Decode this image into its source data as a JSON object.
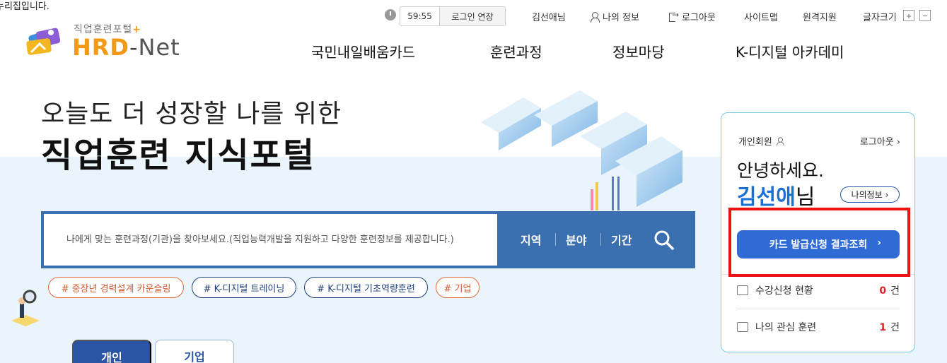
{
  "top_note": "누리집입니다.",
  "logo": {
    "subtitle": "직업훈련포털",
    "plus": "+",
    "main": "HRD",
    "dash": "-",
    "net": "Net"
  },
  "util": {
    "timer": "59:55",
    "extend_label": "로그인 연장",
    "user_greeting": "김선애님",
    "myinfo": "나의 정보",
    "logout": "로그아웃",
    "sitemap": "사이트맵",
    "remote": "원격지원",
    "font_size": "글자크기",
    "plus": "+",
    "minus": "−"
  },
  "gnb": [
    "국민내일배움카드",
    "훈련과정",
    "정보마당",
    "K-디지털 아카데미"
  ],
  "hero": {
    "line1": "오늘도 더 성장할 나를 위한",
    "line2": "직업훈련 지식포털"
  },
  "search": {
    "placeholder": "나에게 맞는 훈련과정(기관)을 찾아보세요.(직업능력개발을 지원하고 다양한 훈련정보를 제공합니다.)",
    "filters": [
      "지역",
      "분야",
      "기간"
    ]
  },
  "tags": [
    {
      "label": "# 중장년 경력설계 카운슬링",
      "style": "orange"
    },
    {
      "label": "# K-디지털 트레이닝",
      "style": "blue"
    },
    {
      "label": "# K-디지털 기초역량훈련",
      "style": "blue"
    },
    {
      "label": "# 기업",
      "style": "orange"
    }
  ],
  "tabs": [
    "개인",
    "기업"
  ],
  "panel": {
    "member_type": "개인회원",
    "logout": "로그아웃",
    "greeting": "안녕하세요.",
    "name": "김선애",
    "suffix": "님",
    "myinfo_btn": "나의정보",
    "card_btn": "카드 발급신청 결과조회",
    "rows": [
      {
        "label": "수강신청 현황",
        "count": "0",
        "unit": "건"
      },
      {
        "label": "나의 관심 훈련",
        "count": "1",
        "unit": "건"
      }
    ]
  },
  "colors": {
    "accent": "#2e6bd5",
    "search_bar": "#3a6fb0",
    "highlight": "#ee1111",
    "logo_orange": "#f29a16"
  }
}
